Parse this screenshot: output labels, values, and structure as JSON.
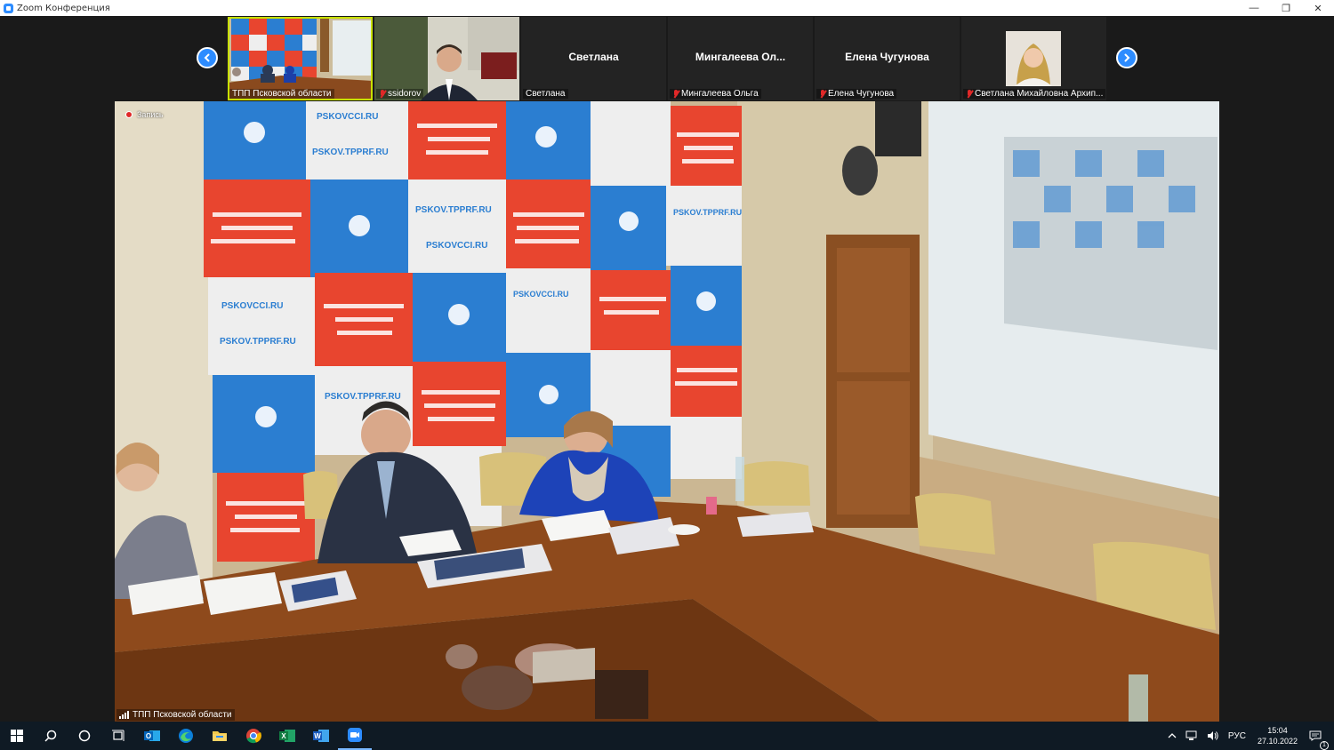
{
  "window": {
    "title": "Zoom Конференция",
    "controls": [
      "—",
      "❐",
      "✕"
    ]
  },
  "gallery": {
    "prev_icon": "chevron-left-icon",
    "next_icon": "chevron-right-icon",
    "tiles": [
      {
        "label": "ТПП Псковской области",
        "muted": false,
        "has_video": true
      },
      {
        "label": "ssidorov",
        "muted": true,
        "has_video": true
      },
      {
        "display_name": "Светлана",
        "label": "Светлана",
        "muted": false,
        "has_video": false
      },
      {
        "display_name": "Мингалеева Ол...",
        "label": "Мингалеева Ольга",
        "muted": true,
        "has_video": false
      },
      {
        "display_name": "Елена Чугунова",
        "label": "Елена Чугунова",
        "muted": true,
        "has_video": false
      },
      {
        "label": "Светлана Михайловна Архип...",
        "muted": true,
        "has_video": true
      }
    ]
  },
  "main": {
    "recording_label": "Запись",
    "speaker_label": "ТПП Псковской области",
    "banner_text": {
      "url1": "PSKOVCCI.RU",
      "url2": "PSKOV.TPPRF.RU",
      "slogan_ru": "ОБЪЕДИНЕНИЕ БИЗНЕСА НА БЛАГО ПСКОВЩИНЫ!",
      "slogan_en": "CONSOLIDATE BUSINESS FOR THE BENEFIT OF THE PSKOV REGION!"
    }
  },
  "taskbar": {
    "apps": [
      "windows-start-icon",
      "search-icon",
      "cortana-icon",
      "task-view-icon",
      "outlook-icon",
      "edge-icon",
      "file-explorer-icon",
      "chrome-icon",
      "excel-icon",
      "word-icon",
      "zoom-icon"
    ],
    "lang": "РУС",
    "time": "15:04",
    "date": "27.10.2022",
    "notification_count": "1"
  },
  "colors": {
    "zoom_blue": "#2d8cff",
    "banner_blue": "#2b7ed1",
    "banner_red": "#e8452f",
    "active_speaker": "#c8e000"
  }
}
